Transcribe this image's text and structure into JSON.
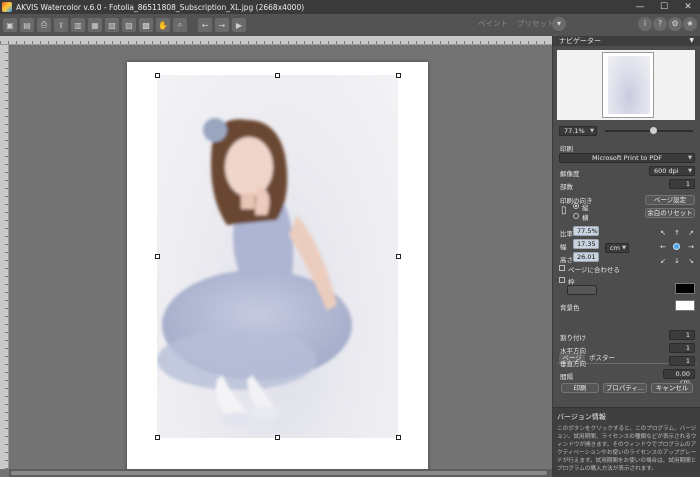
{
  "window": {
    "title": "AKVIS Watercolor v.6.0 - Fotolia_86511808_Subscription_XL.jpg (2668x4000)",
    "min_glyph": "—",
    "max_glyph": "☐",
    "close_glyph": "✕"
  },
  "toolbar": {
    "tabs": [
      "ペイント",
      "プリセット"
    ],
    "icons": [
      "open-icon",
      "save-icon",
      "print-icon",
      "share-icon",
      "undo-icon",
      "redo-icon",
      "settings-icon",
      "help-icon",
      "about-icon"
    ]
  },
  "navigator": {
    "title": "ナビゲーター",
    "zoom": "77.1%",
    "zoom_fraction": 0.55
  },
  "print": {
    "section_label": "印刷",
    "printer": "Microsoft Print to PDF",
    "resolution_label": "解像度",
    "resolution": "600 dpi",
    "copies_label": "部数",
    "copies": "1",
    "orientation_label": "印刷の向き",
    "portrait_label": "縦",
    "landscape_label": "横",
    "page_setup_button": "ページ設定",
    "margin_reset_button": "余白のリセット",
    "scale_label": "比率",
    "scale": "77.5%",
    "width_label": "幅",
    "width": "17.35",
    "height_label": "高さ",
    "height": "26.01",
    "unit": "cm",
    "fit_to_page_label": "ページに合わせる",
    "frame_label": "枠",
    "frame_color": "#000000",
    "bg_color_label": "背景色",
    "bg_color": "#ffffff",
    "tabs": [
      "ページ",
      "ポスター"
    ],
    "pages_label": "割り付け",
    "pages": "1",
    "horizontal_label": "水平方向",
    "horizontal": "1",
    "vertical_label": "垂直方向",
    "vertical": "1",
    "gap_label": "間隔",
    "gap": "0.00 cm",
    "print_button": "印刷",
    "properties_button": "プロパティ...",
    "cancel_button": "キャンセル"
  },
  "info": {
    "title": "バージョン情報",
    "text": "このボタンをクリックすると、このプログラム、バージョン、試用期間、ライセンスの種類などが表示されるウィンドウが開きます。そのウィンドウでプログラムのアクティベーションやお使いのライセンスのアップグレードが行えます。試用期間をお使いの場合は、試用期間とプログラムの購入方法が表示されます。"
  }
}
